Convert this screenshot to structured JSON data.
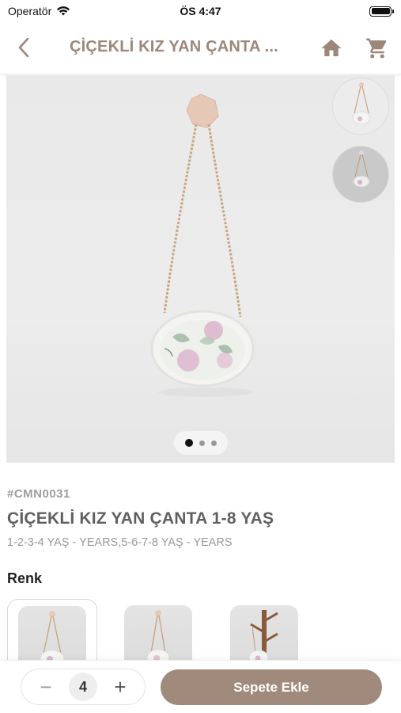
{
  "status_bar": {
    "carrier": "Operatör",
    "time": "ÖS 4:47"
  },
  "nav": {
    "title": "ÇİÇEKLİ KIZ YAN ÇANTA ...",
    "back_icon": "chevron-left-icon",
    "home_icon": "home-icon",
    "cart_icon": "cart-icon"
  },
  "gallery": {
    "image_count": 3,
    "active_index": 0,
    "thumbnail_count": 2
  },
  "product": {
    "sku": "#CMN0031",
    "name": "ÇİÇEKLİ KIZ YAN ÇANTA 1-8 YAŞ",
    "sizes": "1-2-3-4 YAŞ - YEARS,5-6-7-8 YAŞ - YEARS"
  },
  "color_section": {
    "label": "Renk",
    "variant_count": 3,
    "selected_index": 0
  },
  "bottom_bar": {
    "quantity": "4",
    "minus": "−",
    "plus": "+",
    "add_to_cart": "Sepete Ekle"
  },
  "colors": {
    "accent": "#a08a7b",
    "title": "#9d8779"
  }
}
